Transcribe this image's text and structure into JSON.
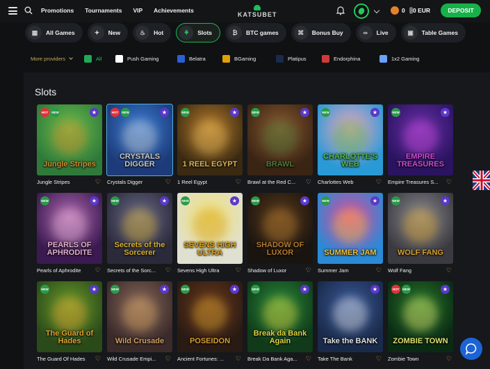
{
  "header": {
    "nav": [
      "Promotions",
      "Tournaments",
      "VIP",
      "Achievements"
    ],
    "logo_text": "KATSUBET",
    "coins": "0",
    "balance": "0 EUR",
    "deposit_label": "DEPOSIT"
  },
  "categories": [
    {
      "label": "All Games",
      "icon": "grid-icon"
    },
    {
      "label": "New",
      "icon": "new-icon"
    },
    {
      "label": "Hot",
      "icon": "flame-icon"
    },
    {
      "label": "Slots",
      "icon": "slots-icon",
      "active": true
    },
    {
      "label": "BTC games",
      "icon": "btc-icon"
    },
    {
      "label": "Bonus Buy",
      "icon": "gift-icon"
    },
    {
      "label": "Live",
      "icon": "live-icon"
    },
    {
      "label": "Table Games",
      "icon": "cards-icon"
    }
  ],
  "providers": {
    "more_label": "More providers",
    "items": [
      "All",
      "Push Gaming",
      "Belatra",
      "BGaming",
      "Platipus",
      "Endorphina",
      "1x2 Gaming"
    ]
  },
  "page_title": "Slots",
  "games": [
    {
      "name": "Jungle Stripes",
      "art": "Jungle Stripes",
      "badges": [
        "HOT",
        "NEW"
      ],
      "star": true,
      "colors": [
        "#2f7a3a",
        "#6bbd4c",
        "#d28a2a"
      ]
    },
    {
      "name": "Crystals Digger",
      "art": "CRYSTALS DIGGER",
      "badges": [
        "HOT",
        "NEW"
      ],
      "star": true,
      "colors": [
        "#1d3b7a",
        "#3b7fd6",
        "#c9c9c9"
      ]
    },
    {
      "name": "1 Reel Egypt",
      "art": "1 REEL EGYPT",
      "badges": [
        "NEW"
      ],
      "star": true,
      "colors": [
        "#3a2a12",
        "#b87d2c",
        "#d9b35a"
      ]
    },
    {
      "name": "Brawl at the Red C...",
      "art": "BRAWL",
      "badges": [
        "NEW"
      ],
      "star": true,
      "colors": [
        "#3a2414",
        "#8a5a30",
        "#4f7a3a"
      ]
    },
    {
      "name": "Charlottes Web",
      "art": "CHARLOTTE'S WEB",
      "badges": [
        "NEW"
      ],
      "star": true,
      "colors": [
        "#2a9ad6",
        "#f1a6c0",
        "#4fb84a"
      ]
    },
    {
      "name": "Empire Treasures S...",
      "art": "EMPIRE TREASURES",
      "badges": [
        "NEW"
      ],
      "star": true,
      "colors": [
        "#2a1460",
        "#6a2ea8",
        "#c94ad6"
      ]
    },
    {
      "name": "Pearls of Aphrodite",
      "art": "PEARLS OF APHRODITE",
      "badges": [
        "NEW"
      ],
      "star": true,
      "colors": [
        "#3a1a50",
        "#b06ab0",
        "#e0b0d0"
      ]
    },
    {
      "name": "Secrets of the Sorc...",
      "art": "Secrets of the Sorcerer",
      "badges": [
        "NEW"
      ],
      "star": true,
      "colors": [
        "#2a2a3a",
        "#6a6a8a",
        "#d6b030"
      ]
    },
    {
      "name": "Sevens High Ultra",
      "art": "SEVENS HIGH ULTRA",
      "badges": [
        "NEW"
      ],
      "star": true,
      "colors": [
        "#e0e0d0",
        "#f0e070",
        "#d6a020"
      ]
    },
    {
      "name": "Shadow of Luxor",
      "art": "SHADOW OF LUXOR",
      "badges": [
        "NEW"
      ],
      "star": true,
      "colors": [
        "#1a1410",
        "#5a3a1a",
        "#b07a30"
      ]
    },
    {
      "name": "Summer Jam",
      "art": "SUMMER JAM",
      "badges": [
        "NEW"
      ],
      "star": true,
      "colors": [
        "#2a8ad6",
        "#e04a9a",
        "#f0c040"
      ]
    },
    {
      "name": "Wolf Fang",
      "art": "WOLF FANG",
      "badges": [
        "NEW"
      ],
      "star": true,
      "colors": [
        "#3a3a40",
        "#8a8a90",
        "#d6a030"
      ]
    },
    {
      "name": "The Guard Of Hades",
      "art": "The Guard of Hades",
      "badges": [
        "NEW"
      ],
      "star": true,
      "colors": [
        "#2a4a1a",
        "#6a9a2a",
        "#e0a030"
      ]
    },
    {
      "name": "Wild Crusade Empi...",
      "art": "Wild Crusade",
      "badges": [
        "NEW"
      ],
      "star": true,
      "colors": [
        "#3a2a2a",
        "#8a6a5a",
        "#d0a060"
      ]
    },
    {
      "name": "Ancient Fortunes: ...",
      "art": "POSEIDON",
      "badges": [
        "NEW"
      ],
      "star": true,
      "colors": [
        "#2a1a14",
        "#6a3a1a",
        "#d6a030"
      ]
    },
    {
      "name": "Break Da Bank Aga...",
      "art": "Break da Bank Again",
      "badges": [
        "NEW"
      ],
      "star": true,
      "colors": [
        "#103a1a",
        "#2a8a3a",
        "#e0d040"
      ]
    },
    {
      "name": "Take The Bank",
      "art": "Take the BANK",
      "badges": [],
      "star": true,
      "colors": [
        "#1a2a4a",
        "#3a5a9a",
        "#e0e0e0"
      ]
    },
    {
      "name": "Zombie Town",
      "art": "ZOMBIE TOWN",
      "badges": [
        "HOT",
        "NEW"
      ],
      "star": true,
      "colors": [
        "#0a2a14",
        "#2a7a2a",
        "#e0e070"
      ]
    }
  ]
}
